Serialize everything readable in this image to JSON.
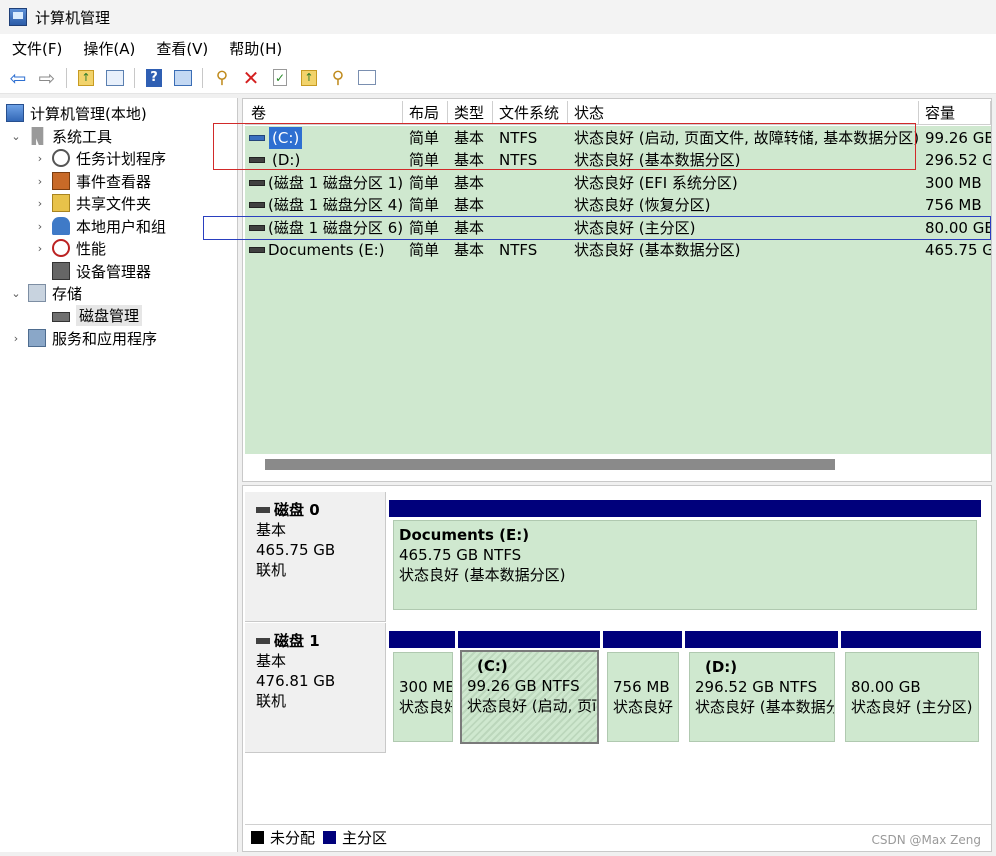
{
  "window": {
    "title": "计算机管理"
  },
  "menu": [
    "文件(F)",
    "操作(A)",
    "查看(V)",
    "帮助(H)"
  ],
  "toolbar": {
    "icons": [
      "back-arrow-icon",
      "forward-arrow-icon",
      "folder-up-icon",
      "show-hide-tree-icon",
      "help-icon",
      "action-pane-icon",
      "connect-icon",
      "delete-icon",
      "properties-icon",
      "export-icon",
      "search-icon",
      "list-icon"
    ]
  },
  "tree": {
    "root": "计算机管理(本地)",
    "system_tools": "系统工具",
    "task_scheduler": "任务计划程序",
    "event_viewer": "事件查看器",
    "shared_folders": "共享文件夹",
    "local_users": "本地用户和组",
    "performance": "性能",
    "device_manager": "设备管理器",
    "storage": "存储",
    "disk_management": "磁盘管理",
    "services_apps": "服务和应用程序"
  },
  "volume_table": {
    "columns": [
      "卷",
      "布局",
      "类型",
      "文件系统",
      "状态",
      "容量"
    ],
    "rows": [
      {
        "vol": "(C:)",
        "layout": "简单",
        "type": "基本",
        "fs": "NTFS",
        "status": "状态良好 (启动, 页面文件, 故障转储, 基本数据分区)",
        "capacity": "99.26 GB"
      },
      {
        "vol": "(D:)",
        "layout": "简单",
        "type": "基本",
        "fs": "NTFS",
        "status": "状态良好 (基本数据分区)",
        "capacity": "296.52 G"
      },
      {
        "vol": "(磁盘 1 磁盘分区 1)",
        "layout": "简单",
        "type": "基本",
        "fs": "",
        "status": "状态良好 (EFI 系统分区)",
        "capacity": "300 MB"
      },
      {
        "vol": "(磁盘 1 磁盘分区 4)",
        "layout": "简单",
        "type": "基本",
        "fs": "",
        "status": "状态良好 (恢复分区)",
        "capacity": "756 MB"
      },
      {
        "vol": "(磁盘 1 磁盘分区 6)",
        "layout": "简单",
        "type": "基本",
        "fs": "",
        "status": "状态良好 (主分区)",
        "capacity": "80.00 GE"
      },
      {
        "vol": "Documents (E:)",
        "layout": "简单",
        "type": "基本",
        "fs": "NTFS",
        "status": "状态良好 (基本数据分区)",
        "capacity": "465.75 G"
      }
    ]
  },
  "disks": [
    {
      "name": "磁盘 0",
      "kind": "基本",
      "size": "465.75 GB",
      "state": "联机",
      "partitions": [
        {
          "name": "Documents  (E:)",
          "line1": "465.75 GB NTFS",
          "line2": "状态良好 (基本数据分区)"
        }
      ]
    },
    {
      "name": "磁盘 1",
      "kind": "基本",
      "size": "476.81 GB",
      "state": "联机",
      "partitions": [
        {
          "name": "",
          "line1": "300 ME",
          "line2": "状态良好"
        },
        {
          "name": "(C:)",
          "line1": "99.26 GB NTFS",
          "line2": "状态良好 (启动, 页ī"
        },
        {
          "name": "",
          "line1": "756 MB",
          "line2": "状态良好"
        },
        {
          "name": "(D:)",
          "line1": "296.52 GB NTFS",
          "line2": "状态良好 (基本数据分"
        },
        {
          "name": "",
          "line1": "80.00 GB",
          "line2": "状态良好 (主分区)"
        }
      ]
    }
  ],
  "legend": [
    {
      "label": "未分配",
      "color": "#000000"
    },
    {
      "label": "主分区",
      "color": "#00007b"
    }
  ],
  "watermark": "CSDN @Max Zeng",
  "colors": {
    "partition_fill": "#cfe8cf",
    "partition_header": "#00007b",
    "selection": "#2e6fd1"
  }
}
